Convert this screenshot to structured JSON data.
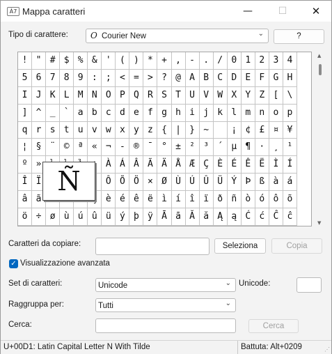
{
  "window": {
    "title": "Mappa caratteri",
    "icon_text": "À7",
    "minimize": "—",
    "maximize": "☐",
    "close": "✕"
  },
  "font_row": {
    "label": "Tipo di carattere:",
    "font_glyph": "O",
    "font_value": "Courier New",
    "help_button": "?"
  },
  "grid": {
    "selected_magnified": "Ñ",
    "cells": [
      "!",
      "\"",
      "#",
      "$",
      "%",
      "&",
      "'",
      "(",
      ")",
      "*",
      "+",
      ",",
      "-",
      ".",
      "/",
      "0",
      "1",
      "2",
      "3",
      "4",
      "5",
      "6",
      "7",
      "8",
      "9",
      ":",
      ";",
      "<",
      "=",
      ">",
      "?",
      "@",
      "A",
      "B",
      "C",
      "D",
      "E",
      "F",
      "G",
      "H",
      "I",
      "J",
      "K",
      "L",
      "M",
      "N",
      "O",
      "P",
      "Q",
      "R",
      "S",
      "T",
      "U",
      "V",
      "W",
      "X",
      "Y",
      "Z",
      "[",
      "\\",
      "]",
      "^",
      "_",
      "`",
      "a",
      "b",
      "c",
      "d",
      "e",
      "f",
      "g",
      "h",
      "i",
      "j",
      "k",
      "l",
      "m",
      "n",
      "o",
      "p",
      "q",
      "r",
      "s",
      "t",
      "u",
      "v",
      "w",
      "x",
      "y",
      "z",
      "{",
      "|",
      "}",
      "~",
      " ",
      "¡",
      "¢",
      "£",
      "¤",
      "¥",
      "¦",
      "§",
      "¨",
      "©",
      "ª",
      "«",
      "¬",
      "-",
      "®",
      "¯",
      "°",
      "±",
      "²",
      "³",
      "´",
      "µ",
      "¶",
      "·",
      "¸",
      "¹",
      "º",
      "»",
      "¼",
      "½",
      "¾",
      "¿",
      "À",
      "Á",
      "Â",
      "Ã",
      "Ä",
      "Å",
      "Æ",
      "Ç",
      "È",
      "É",
      "Ê",
      "Ë",
      "Ì",
      "Í",
      "Î",
      "Ï",
      "Ð",
      "Ñ",
      "Ò",
      "Ó",
      "Ô",
      "Õ",
      "Ö",
      "×",
      "Ø",
      "Ù",
      "Ú",
      "Û",
      "Ü",
      "Ý",
      "Þ",
      "ß",
      "à",
      "á",
      "â",
      "ã",
      "ä",
      "å",
      "æ",
      "ç",
      "è",
      "é",
      "ê",
      "ë",
      "ì",
      "í",
      "î",
      "ï",
      "ð",
      "ñ",
      "ò",
      "ó",
      "ô",
      "õ",
      "ö",
      "÷",
      "ø",
      "ù",
      "ú",
      "û",
      "ü",
      "ý",
      "þ",
      "ÿ",
      "Ā",
      "ā",
      "Ă",
      "ă",
      "Ą",
      "ą",
      "Ć",
      "ć",
      "Ĉ",
      "ĉ"
    ]
  },
  "copy_row": {
    "label": "Caratteri da copiare:",
    "value": "",
    "select_button": "Seleziona",
    "copy_button": "Copia"
  },
  "advanced": {
    "label": "Visualizzazione avanzata",
    "checked": true
  },
  "charset_row": {
    "label": "Set di caratteri:",
    "value": "Unicode",
    "unicode_label": "Unicode:",
    "unicode_value": ""
  },
  "group_row": {
    "label": "Raggruppa per:",
    "value": "Tutti"
  },
  "search_row": {
    "label": "Cerca:",
    "value": "",
    "search_button": "Cerca"
  },
  "status": {
    "char_info": "U+00D1: Latin Capital Letter N With Tilde",
    "keystroke": "Battuta: Alt+0209"
  }
}
